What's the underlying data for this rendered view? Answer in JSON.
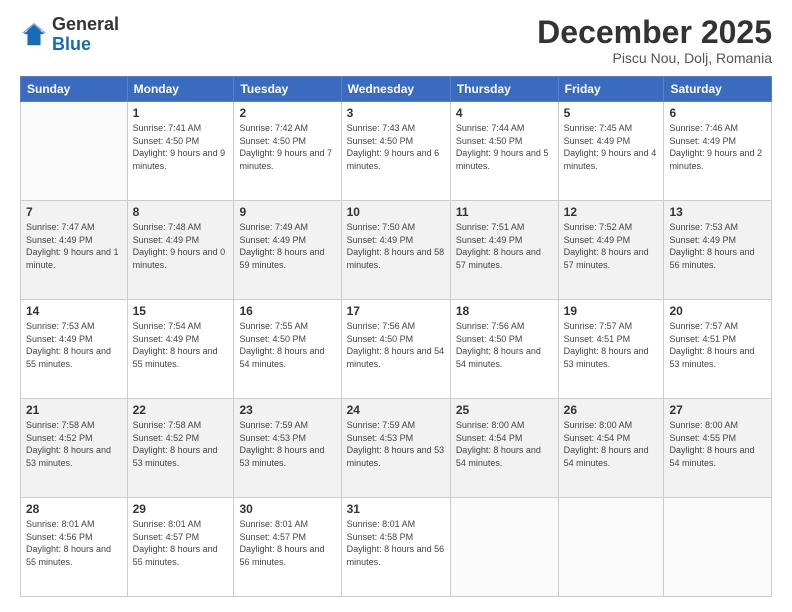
{
  "logo": {
    "general": "General",
    "blue": "Blue"
  },
  "header": {
    "month": "December 2025",
    "location": "Piscu Nou, Dolj, Romania"
  },
  "weekdays": [
    "Sunday",
    "Monday",
    "Tuesday",
    "Wednesday",
    "Thursday",
    "Friday",
    "Saturday"
  ],
  "weeks": [
    [
      {
        "day": "",
        "sunrise": "",
        "sunset": "",
        "daylight": ""
      },
      {
        "day": "1",
        "sunrise": "Sunrise: 7:41 AM",
        "sunset": "Sunset: 4:50 PM",
        "daylight": "Daylight: 9 hours and 9 minutes."
      },
      {
        "day": "2",
        "sunrise": "Sunrise: 7:42 AM",
        "sunset": "Sunset: 4:50 PM",
        "daylight": "Daylight: 9 hours and 7 minutes."
      },
      {
        "day": "3",
        "sunrise": "Sunrise: 7:43 AM",
        "sunset": "Sunset: 4:50 PM",
        "daylight": "Daylight: 9 hours and 6 minutes."
      },
      {
        "day": "4",
        "sunrise": "Sunrise: 7:44 AM",
        "sunset": "Sunset: 4:50 PM",
        "daylight": "Daylight: 9 hours and 5 minutes."
      },
      {
        "day": "5",
        "sunrise": "Sunrise: 7:45 AM",
        "sunset": "Sunset: 4:49 PM",
        "daylight": "Daylight: 9 hours and 4 minutes."
      },
      {
        "day": "6",
        "sunrise": "Sunrise: 7:46 AM",
        "sunset": "Sunset: 4:49 PM",
        "daylight": "Daylight: 9 hours and 2 minutes."
      }
    ],
    [
      {
        "day": "7",
        "sunrise": "Sunrise: 7:47 AM",
        "sunset": "Sunset: 4:49 PM",
        "daylight": "Daylight: 9 hours and 1 minute."
      },
      {
        "day": "8",
        "sunrise": "Sunrise: 7:48 AM",
        "sunset": "Sunset: 4:49 PM",
        "daylight": "Daylight: 9 hours and 0 minutes."
      },
      {
        "day": "9",
        "sunrise": "Sunrise: 7:49 AM",
        "sunset": "Sunset: 4:49 PM",
        "daylight": "Daylight: 8 hours and 59 minutes."
      },
      {
        "day": "10",
        "sunrise": "Sunrise: 7:50 AM",
        "sunset": "Sunset: 4:49 PM",
        "daylight": "Daylight: 8 hours and 58 minutes."
      },
      {
        "day": "11",
        "sunrise": "Sunrise: 7:51 AM",
        "sunset": "Sunset: 4:49 PM",
        "daylight": "Daylight: 8 hours and 57 minutes."
      },
      {
        "day": "12",
        "sunrise": "Sunrise: 7:52 AM",
        "sunset": "Sunset: 4:49 PM",
        "daylight": "Daylight: 8 hours and 57 minutes."
      },
      {
        "day": "13",
        "sunrise": "Sunrise: 7:53 AM",
        "sunset": "Sunset: 4:49 PM",
        "daylight": "Daylight: 8 hours and 56 minutes."
      }
    ],
    [
      {
        "day": "14",
        "sunrise": "Sunrise: 7:53 AM",
        "sunset": "Sunset: 4:49 PM",
        "daylight": "Daylight: 8 hours and 55 minutes."
      },
      {
        "day": "15",
        "sunrise": "Sunrise: 7:54 AM",
        "sunset": "Sunset: 4:49 PM",
        "daylight": "Daylight: 8 hours and 55 minutes."
      },
      {
        "day": "16",
        "sunrise": "Sunrise: 7:55 AM",
        "sunset": "Sunset: 4:50 PM",
        "daylight": "Daylight: 8 hours and 54 minutes."
      },
      {
        "day": "17",
        "sunrise": "Sunrise: 7:56 AM",
        "sunset": "Sunset: 4:50 PM",
        "daylight": "Daylight: 8 hours and 54 minutes."
      },
      {
        "day": "18",
        "sunrise": "Sunrise: 7:56 AM",
        "sunset": "Sunset: 4:50 PM",
        "daylight": "Daylight: 8 hours and 54 minutes."
      },
      {
        "day": "19",
        "sunrise": "Sunrise: 7:57 AM",
        "sunset": "Sunset: 4:51 PM",
        "daylight": "Daylight: 8 hours and 53 minutes."
      },
      {
        "day": "20",
        "sunrise": "Sunrise: 7:57 AM",
        "sunset": "Sunset: 4:51 PM",
        "daylight": "Daylight: 8 hours and 53 minutes."
      }
    ],
    [
      {
        "day": "21",
        "sunrise": "Sunrise: 7:58 AM",
        "sunset": "Sunset: 4:52 PM",
        "daylight": "Daylight: 8 hours and 53 minutes."
      },
      {
        "day": "22",
        "sunrise": "Sunrise: 7:58 AM",
        "sunset": "Sunset: 4:52 PM",
        "daylight": "Daylight: 8 hours and 53 minutes."
      },
      {
        "day": "23",
        "sunrise": "Sunrise: 7:59 AM",
        "sunset": "Sunset: 4:53 PM",
        "daylight": "Daylight: 8 hours and 53 minutes."
      },
      {
        "day": "24",
        "sunrise": "Sunrise: 7:59 AM",
        "sunset": "Sunset: 4:53 PM",
        "daylight": "Daylight: 8 hours and 53 minutes."
      },
      {
        "day": "25",
        "sunrise": "Sunrise: 8:00 AM",
        "sunset": "Sunset: 4:54 PM",
        "daylight": "Daylight: 8 hours and 54 minutes."
      },
      {
        "day": "26",
        "sunrise": "Sunrise: 8:00 AM",
        "sunset": "Sunset: 4:54 PM",
        "daylight": "Daylight: 8 hours and 54 minutes."
      },
      {
        "day": "27",
        "sunrise": "Sunrise: 8:00 AM",
        "sunset": "Sunset: 4:55 PM",
        "daylight": "Daylight: 8 hours and 54 minutes."
      }
    ],
    [
      {
        "day": "28",
        "sunrise": "Sunrise: 8:01 AM",
        "sunset": "Sunset: 4:56 PM",
        "daylight": "Daylight: 8 hours and 55 minutes."
      },
      {
        "day": "29",
        "sunrise": "Sunrise: 8:01 AM",
        "sunset": "Sunset: 4:57 PM",
        "daylight": "Daylight: 8 hours and 55 minutes."
      },
      {
        "day": "30",
        "sunrise": "Sunrise: 8:01 AM",
        "sunset": "Sunset: 4:57 PM",
        "daylight": "Daylight: 8 hours and 56 minutes."
      },
      {
        "day": "31",
        "sunrise": "Sunrise: 8:01 AM",
        "sunset": "Sunset: 4:58 PM",
        "daylight": "Daylight: 8 hours and 56 minutes."
      },
      {
        "day": "",
        "sunrise": "",
        "sunset": "",
        "daylight": ""
      },
      {
        "day": "",
        "sunrise": "",
        "sunset": "",
        "daylight": ""
      },
      {
        "day": "",
        "sunrise": "",
        "sunset": "",
        "daylight": ""
      }
    ]
  ]
}
